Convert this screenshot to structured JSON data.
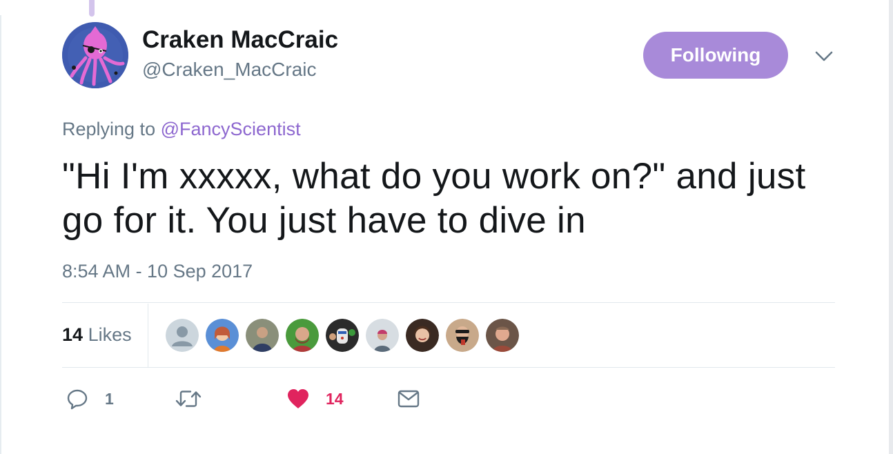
{
  "tweet": {
    "author": {
      "display_name": "Craken MacCraic",
      "handle": "@Craken_MacCraic"
    },
    "follow_button_label": "Following",
    "replying_to_prefix": "Replying to",
    "replying_to_handle": "@FancyScientist",
    "text": "\"Hi I'm xxxxx, what do you work on?\" and just go for it. You just have to dive in",
    "timestamp": "8:54 AM - 10 Sep 2017"
  },
  "stats": {
    "likes_count": "14",
    "likes_label": "Likes"
  },
  "actions": {
    "reply_count": "1",
    "retweet_count": "",
    "like_count": "14"
  },
  "colors": {
    "accent": "#a88ad9",
    "mention": "#8d67cf",
    "like": "#e0245e",
    "muted_text": "#657786",
    "thread_line": "#d3c4ec"
  },
  "icons": {
    "reply": "speech-bubble",
    "retweet": "retweet-arrows",
    "like": "heart-filled",
    "dm": "envelope",
    "menu": "chevron-down"
  }
}
